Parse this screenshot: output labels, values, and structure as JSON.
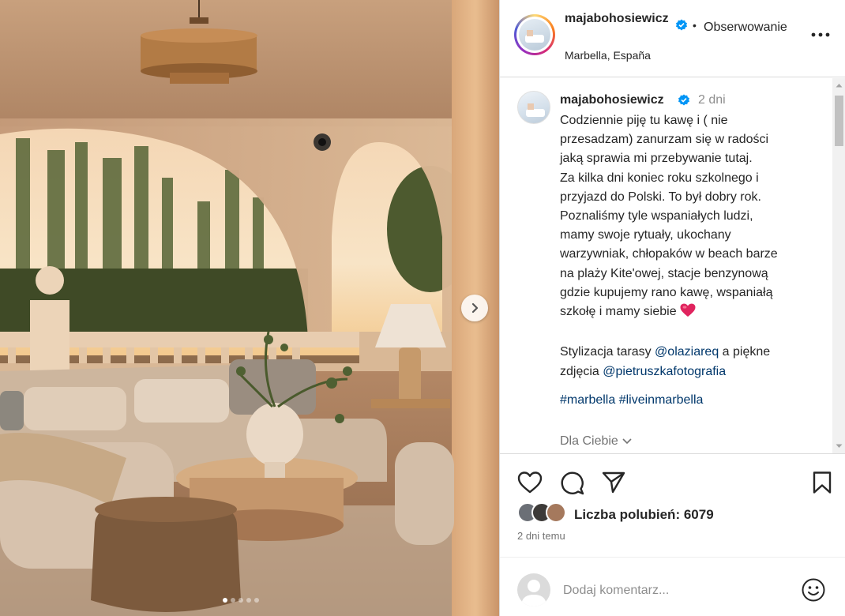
{
  "post": {
    "username": "majabohosiewicz",
    "follow_label": "Obserwowanie",
    "separator": "•",
    "location": "Marbella, España",
    "time_short": "2 dni",
    "caption_lines": [
      "Codziennie piję tu kawę i ( nie",
      "przesadzam) zanurzam się w radości",
      "jaką sprawia mi przebywanie tutaj.",
      "Za kilka dni koniec roku szkolnego i",
      "przyjazd do Polski. To był dobry rok.",
      "Poznaliśmy tyle wspaniałych ludzi,",
      "mamy swoje rytuały, ukochany",
      "warzywniak, chłopaków w beach barze",
      "na plaży Kite'owej, stacje benzynową",
      "gdzie kupujemy rano kawę, wspaniałą",
      "szkołę i mamy siebie"
    ],
    "styling_prefix": "Stylizacja tarasy ",
    "styling_mention": "@olaziareq",
    "styling_middle": " a piękne",
    "photo_prefix": "zdjęcia ",
    "photo_mention": "@pietruszkafotografia",
    "hashtags": [
      "#marbella",
      "#liveinmarbella"
    ],
    "for_you_label": "Dla Ciebie",
    "likes_label": "Liczba polubień: 6079",
    "posted_ago": "2 dni temu",
    "comment_placeholder": "Dodaj komentarz..."
  },
  "carousel": {
    "total": 5,
    "current": 1
  },
  "colors": {
    "link": "#00376b",
    "verified": "#0095f6",
    "heart": "#e0245e"
  },
  "icons": [
    "verified-icon",
    "more-icon",
    "like-icon",
    "comment-icon",
    "share-icon",
    "save-icon",
    "emoji-icon",
    "chevron-right-icon",
    "chevron-down-icon",
    "red-heart-emoji"
  ]
}
